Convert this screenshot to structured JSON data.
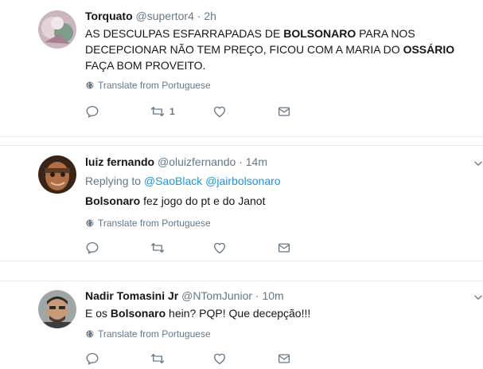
{
  "translate_label": "Translate from Portuguese",
  "tweets": [
    {
      "name": "Torquato",
      "handle": "@supertor4",
      "time": "2h",
      "text": [
        {
          "t": "AS DESCULPAS ESFARRAPADAS DE ",
          "b": false
        },
        {
          "t": "BOLSONARO",
          "b": true
        },
        {
          "t": " PARA NOS DECEPCIONAR NÃO TEM PREÇO, FICOU COM A MARIA DO ",
          "b": false
        },
        {
          "t": "OSSÁRIO",
          "b": true
        },
        {
          "t": " FAÇA BOM PROVEITO.",
          "b": false
        }
      ],
      "retweets": "1"
    },
    {
      "name": "luiz fernando",
      "handle": "@oluizfernando",
      "time": "14m",
      "replying_label": "Replying to",
      "replying_to": [
        "@SaoBlack",
        "@jairbolsonaro"
      ],
      "text": [
        {
          "t": "Bolsonaro",
          "b": true
        },
        {
          "t": " fez jogo do pt e do Janot",
          "b": false
        }
      ]
    },
    {
      "name": "Nadir Tomasini Jr",
      "handle": "@NTomJunior",
      "time": "10m",
      "text": [
        {
          "t": "E os ",
          "b": false
        },
        {
          "t": "Bolsonaro",
          "b": true
        },
        {
          "t": " hein? PQP! Que decepção!!!",
          "b": false
        }
      ]
    }
  ],
  "colors": {
    "text": "#14171a",
    "secondary": "#657786",
    "link": "#1b95e0",
    "border": "#e6ecf0"
  }
}
